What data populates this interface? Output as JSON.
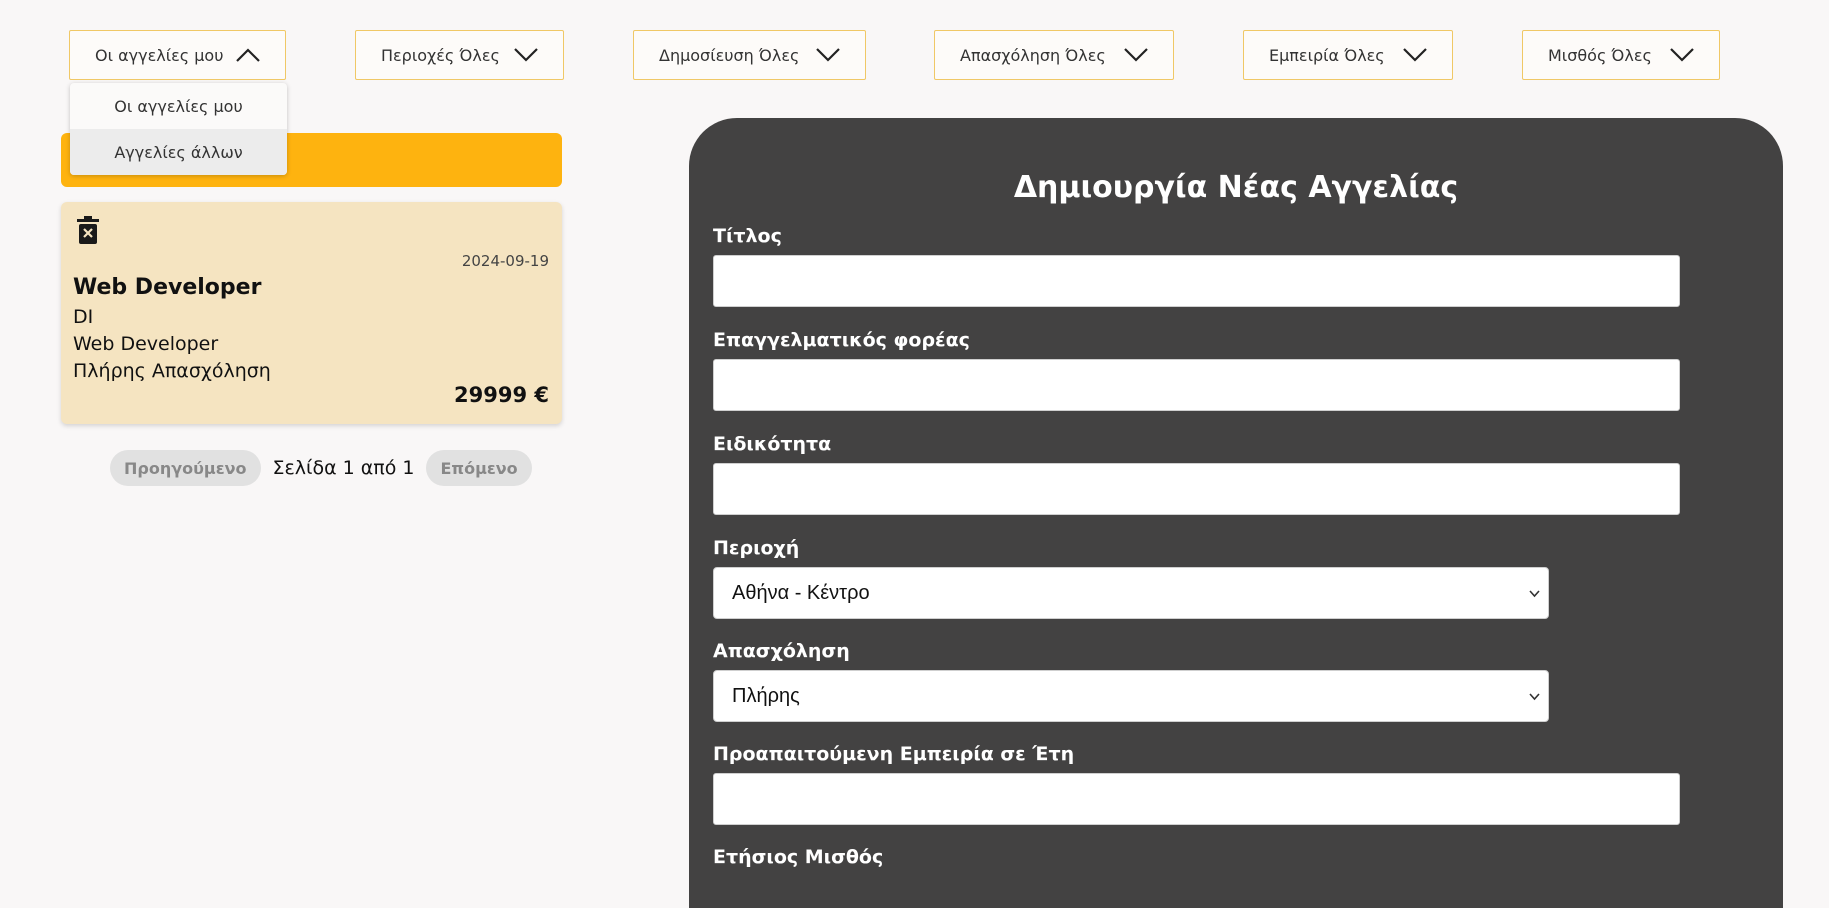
{
  "filters": [
    {
      "label": "Οι αγγελίες μου",
      "expanded": true
    },
    {
      "label": "Περιοχές Όλες",
      "expanded": false
    },
    {
      "label": "Δημοσίευση Όλες",
      "expanded": false
    },
    {
      "label": "Απασχόληση Όλες",
      "expanded": false
    },
    {
      "label": "Εμπειρία Όλες",
      "expanded": false
    },
    {
      "label": "Μισθός Όλες",
      "expanded": false
    }
  ],
  "ads_dropdown": {
    "options": [
      "Οι αγγελίες μου",
      "Αγγελίες άλλων"
    ],
    "hovered": "Αγγελίες άλλων"
  },
  "job_card": {
    "date": "2024-09-19",
    "title": "Web Developer",
    "company": "DI",
    "specialty": "Web Developer",
    "employment": "Πλήρης Απασχόληση",
    "salary": "29999 €",
    "delete_icon": "trash-x-icon"
  },
  "pagination": {
    "prev_label": "Προηγούμενο",
    "info": "Σελίδα 1 από 1",
    "next_label": "Επόμενο"
  },
  "form": {
    "title": "Δημιουργία Νέας Αγγελίας",
    "title_label": "Τίτλος",
    "title_value": "",
    "company_label": "Επαγγελματικός φορέας",
    "company_value": "",
    "specialty_label": "Ειδικότητα",
    "specialty_value": "",
    "region_label": "Περιοχή",
    "region_value": "Αθήνα - Κέντρο",
    "employment_label": "Απασχόληση",
    "employment_value": "Πλήρης",
    "experience_label": "Προαπαιτούμενη Εμπειρία σε Έτη",
    "experience_value": "",
    "salary_label": "Ετήσιος Μισθός"
  },
  "colors": {
    "accent": "#feb30f",
    "card_bg": "#f5e4c1",
    "panel_bg": "#434242",
    "page_bg": "#f9f7f7",
    "filter_border": "#f0c866"
  }
}
